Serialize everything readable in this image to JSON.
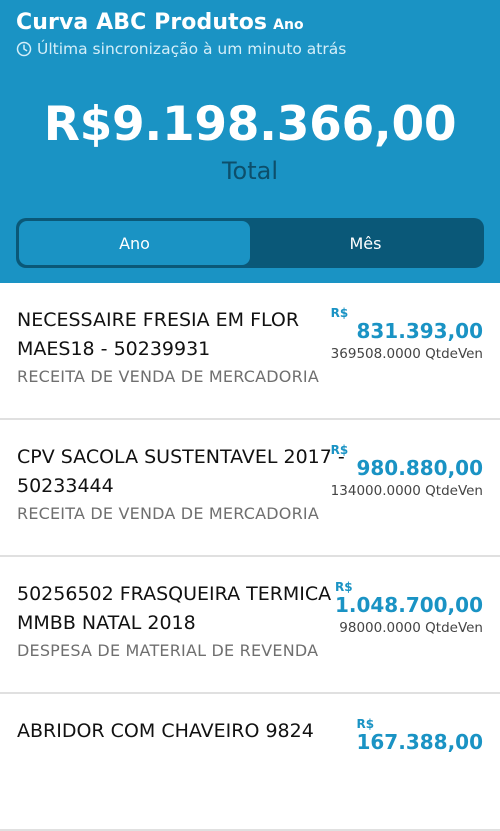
{
  "header": {
    "title": "Curva ABC Produtos",
    "period": "Ano",
    "sync_text": "Última sincronização à um minuto atrás",
    "total_amount": "R$9.198.366,00",
    "total_label": "Total"
  },
  "tabs": [
    {
      "label": "Ano",
      "active": true
    },
    {
      "label": "Mês",
      "active": false
    }
  ],
  "products": [
    {
      "name": "NECESSAIRE FRESIA EM FLOR MAES18 - 50239931",
      "account": "RECEITA DE VENDA DE MERCADORIA",
      "currency": "R$",
      "amount": "831.393,00",
      "qty": "369508.0000 QtdeVen"
    },
    {
      "name": "CPV SACOLA SUSTENTAVEL 2017 - 50233444",
      "account": "RECEITA DE VENDA DE MERCADORIA",
      "currency": "R$",
      "amount": "980.880,00",
      "qty": "134000.0000 QtdeVen"
    },
    {
      "name": "50256502 FRASQUEIRA TERMICA MMBB NATAL 2018",
      "account": "DESPESA DE MATERIAL DE REVENDA",
      "currency": "R$",
      "amount": "1.048.700,00",
      "qty": "98000.0000 QtdeVen"
    },
    {
      "name": "ABRIDOR COM CHAVEIRO 9824",
      "account": "",
      "currency": "R$",
      "amount": "167.388,00",
      "qty": ""
    }
  ],
  "colors": {
    "primary": "#1a93c4",
    "dark": "#0a5878"
  }
}
